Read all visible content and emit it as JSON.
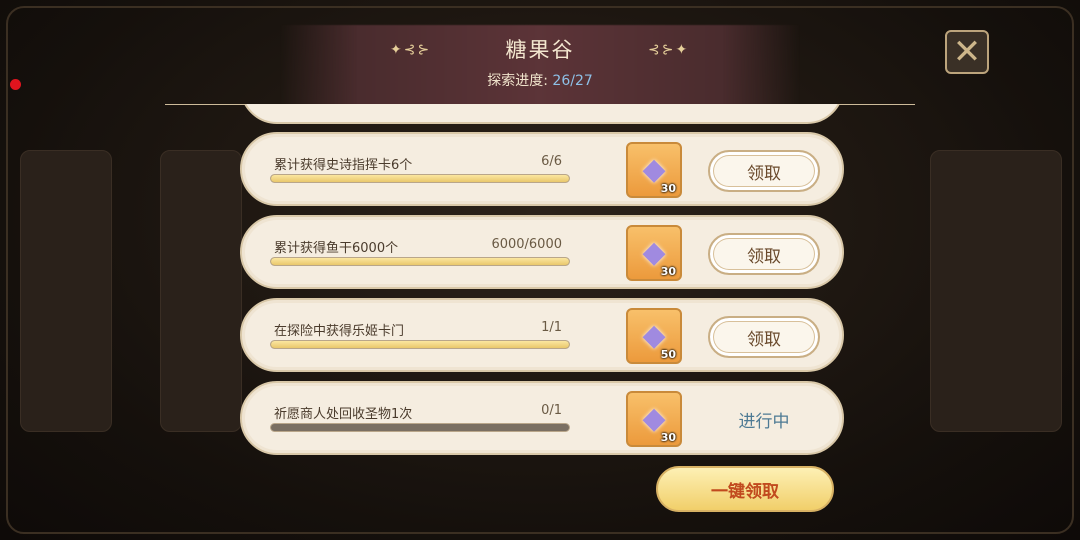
{
  "header": {
    "title": "糖果谷",
    "progress_label": "探索进度:",
    "progress_value": "26/27"
  },
  "tasks": [
    {
      "name": "累计获得史诗指挥卡6个",
      "count": "6/6",
      "progress": 1.0,
      "reward_icon": "diamond-icon",
      "reward_qty": "30",
      "action": "领取",
      "state": "claimable"
    },
    {
      "name": "累计获得鱼干6000个",
      "count": "6000/6000",
      "progress": 1.0,
      "reward_icon": "diamond-icon",
      "reward_qty": "30",
      "action": "领取",
      "state": "claimable"
    },
    {
      "name": "在探险中获得乐姬卡门",
      "count": "1/1",
      "progress": 1.0,
      "reward_icon": "diamond-icon",
      "reward_qty": "50",
      "action": "领取",
      "state": "claimable"
    },
    {
      "name": "祈愿商人处回收圣物1次",
      "count": "0/1",
      "progress": 0.0,
      "reward_icon": "diamond-icon",
      "reward_qty": "30",
      "action": "进行中",
      "state": "in-progress"
    }
  ],
  "footer": {
    "claim_all_label": "一键领取"
  },
  "colors": {
    "accent_gold": "#f1cf6a",
    "progress_text": "#8ec0e6",
    "status_text": "#4d7a94",
    "claim_all_text": "#c14a1e"
  }
}
